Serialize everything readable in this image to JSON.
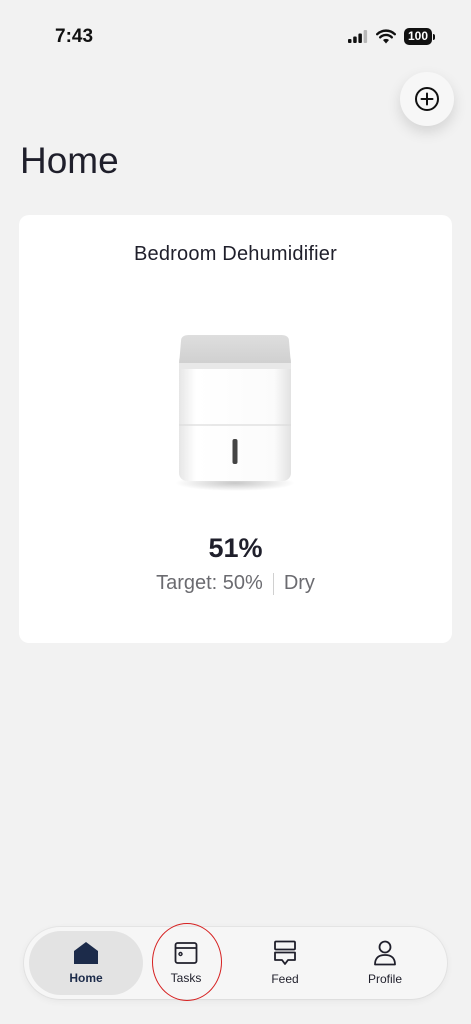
{
  "status_bar": {
    "time": "7:43",
    "battery": "100",
    "icons": [
      "cellular-signal-icon",
      "wifi-icon",
      "battery-icon"
    ]
  },
  "header": {
    "title": "Home",
    "add_icon": "plus-circle-icon"
  },
  "device_card": {
    "name": "Bedroom Dehumidifier",
    "humidity": "51%",
    "target": "Target: 50%",
    "mode": "Dry",
    "image": "dehumidifier-image"
  },
  "tab_bar": {
    "active": "Home",
    "tabs": [
      {
        "label": "Home",
        "icon": "home-icon"
      },
      {
        "label": "Tasks",
        "icon": "tasks-icon"
      },
      {
        "label": "Feed",
        "icon": "feed-icon"
      },
      {
        "label": "Profile",
        "icon": "profile-icon"
      }
    ]
  },
  "colors": {
    "background": "#f2f2f2",
    "card": "#ffffff",
    "active_tab": "#1c2b4a",
    "highlight_ring": "#d62020"
  }
}
